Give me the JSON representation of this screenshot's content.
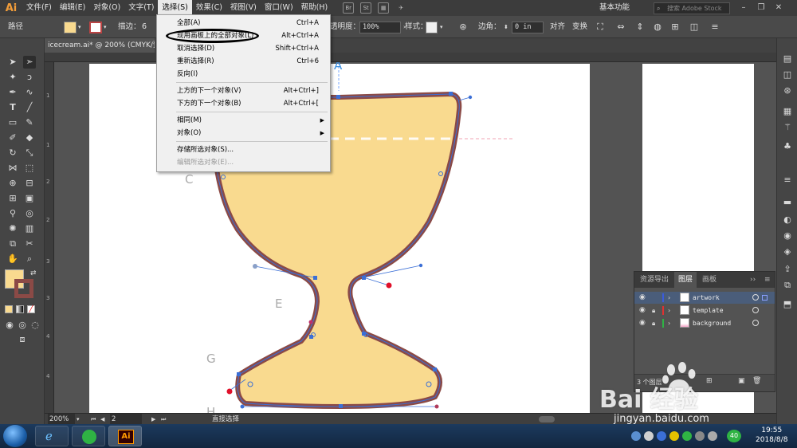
{
  "app": {
    "logo": "Ai",
    "menus": [
      "文件(F)",
      "编辑(E)",
      "对象(O)",
      "文字(T)",
      "选择(S)",
      "效果(C)",
      "视图(V)",
      "窗口(W)",
      "帮助(H)"
    ],
    "bridge_icon": "Br",
    "stock_icon": "St",
    "workspace": "基本功能",
    "search_placeholder": "搜索 Adobe Stock"
  },
  "control_bar": {
    "path_label": "路径",
    "stroke_label": "描边：",
    "stroke_value": "6",
    "opacity_label": "透明度：",
    "opacity_value": "100%",
    "style_label": "样式：",
    "corner_label": "边角：",
    "corner_value": "0 in",
    "align_label": "对齐",
    "transform_label": "变换"
  },
  "document": {
    "tab_title": "icecream.ai* @ 200% (CMYK/预"
  },
  "select_menu": {
    "items": [
      {
        "label": "全部(A)",
        "shortcut": "Ctrl+A"
      },
      {
        "label": "现用画板上的全部对象(L)",
        "shortcut": "Alt+Ctrl+A"
      },
      {
        "label": "取消选择(D)",
        "shortcut": "Shift+Ctrl+A"
      },
      {
        "label": "重新选择(R)",
        "shortcut": "Ctrl+6"
      },
      {
        "label": "反向(I)",
        "shortcut": ""
      },
      {
        "label": "上方的下一个对象(V)",
        "shortcut": "Alt+Ctrl+]"
      },
      {
        "label": "下方的下一个对象(B)",
        "shortcut": "Alt+Ctrl+["
      },
      {
        "label": "相同(M)",
        "shortcut": ""
      },
      {
        "label": "对象(O)",
        "shortcut": ""
      },
      {
        "label": "存储所选对象(S)...",
        "shortcut": ""
      },
      {
        "label": "编辑所选对象(E)...",
        "shortcut": ""
      }
    ]
  },
  "canvas": {
    "guide_letters": [
      "A",
      "C",
      "E",
      "G",
      "H"
    ],
    "fill_color": "#f9da8f",
    "stroke_color": "#8b4a46",
    "anchor_color": "#3b6fd6"
  },
  "layers_panel": {
    "tabs": [
      "资源导出",
      "图层",
      "画板"
    ],
    "layers": [
      {
        "name": "artwork",
        "color": "#3b5bdb"
      },
      {
        "name": "template",
        "color": "#e03131"
      },
      {
        "name": "background",
        "color": "#2fb344"
      }
    ],
    "footer_text": "3 个图层"
  },
  "status_bar": {
    "zoom": "200%",
    "artboard_number": "2",
    "tool_name": "直接选择"
  },
  "taskbar": {
    "time": "19:55",
    "date": "2018/8/8",
    "badge": "40"
  },
  "watermark": {
    "brand": "Bai  经验",
    "url": "jingyan.baidu.com"
  }
}
